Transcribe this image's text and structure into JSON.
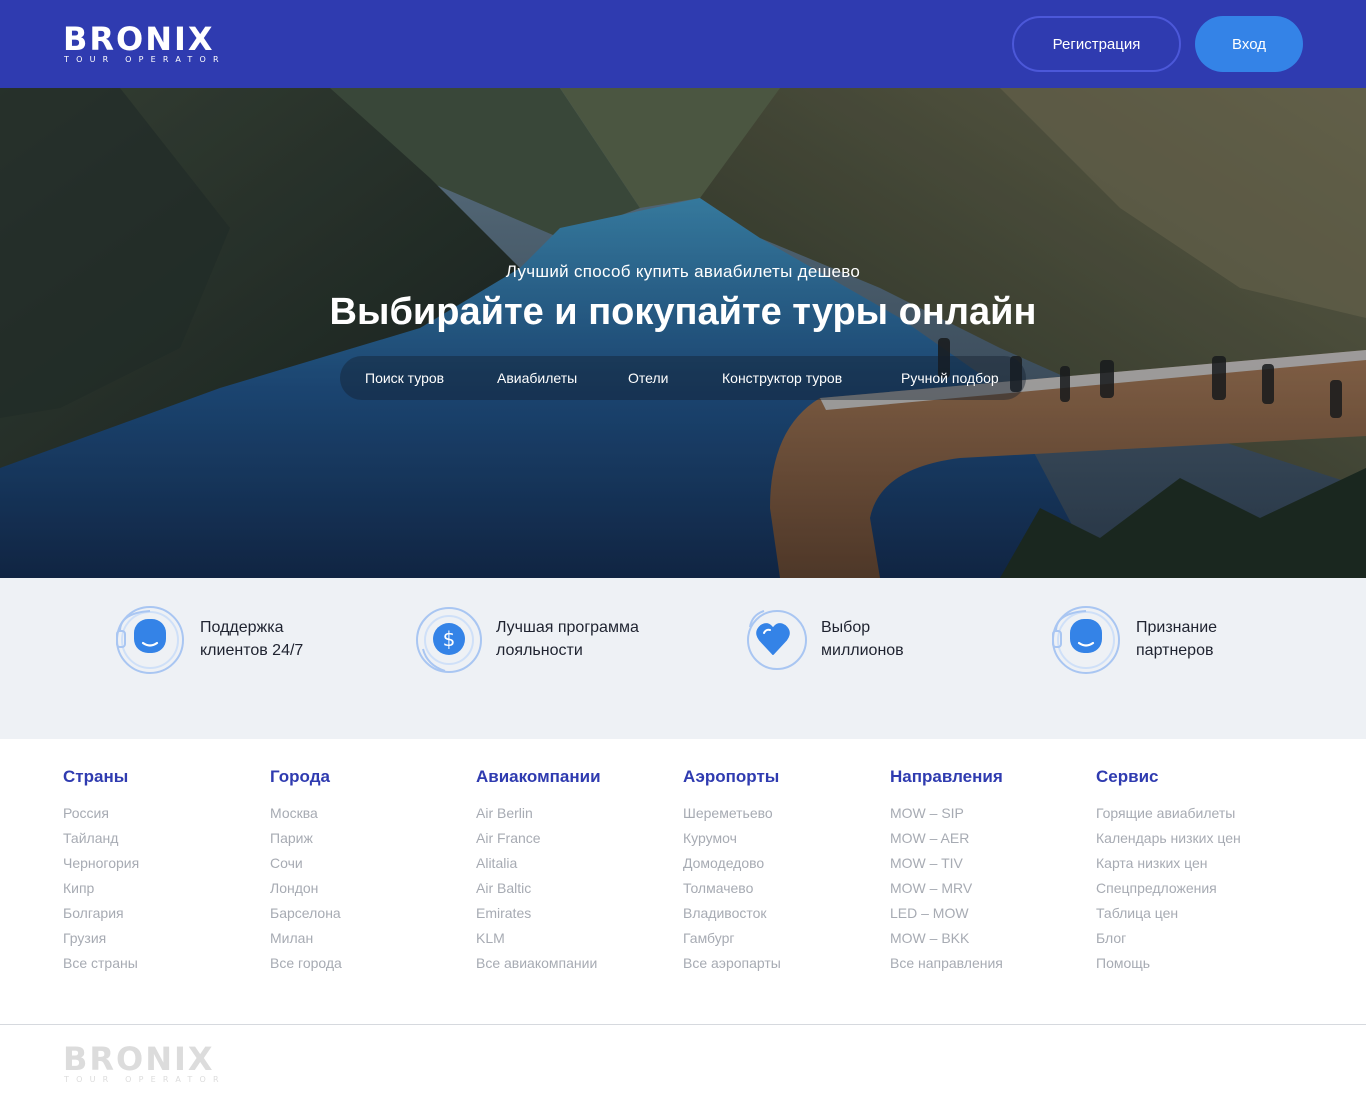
{
  "header": {
    "logo_word": "BRONIX",
    "logo_sub": "TOUR OPERATOR",
    "register_label": "Регистрация",
    "login_label": "Вход"
  },
  "hero": {
    "subtitle": "Лучший способ купить авиабилеты дешево",
    "title": "Выбирайте и покупайте туры онлайн",
    "tabs": [
      "Поиск туров",
      "Авиабилеты",
      "Отели",
      "Конструктор туров",
      "Ручной подбор"
    ]
  },
  "features": [
    {
      "icon": "support-headset-icon",
      "line1": "Поддержка",
      "line2": "клиентов 24/7"
    },
    {
      "icon": "dollar-coin-icon",
      "line1": "Лучшая программа",
      "line2": "лояльности"
    },
    {
      "icon": "heart-icon",
      "line1": "Выбор",
      "line2": "миллионов"
    },
    {
      "icon": "support-headset-icon",
      "line1": "Признание",
      "line2": "партнеров"
    }
  ],
  "footer": {
    "columns": [
      {
        "title": "Страны",
        "links": [
          "Россия",
          "Тайланд",
          "Черногория",
          "Кипр",
          "Болгария",
          "Грузия",
          "Все страны"
        ]
      },
      {
        "title": "Города",
        "links": [
          "Москва",
          "Париж",
          "Сочи",
          "Лондон",
          "Барселона",
          "Милан",
          "Все города"
        ]
      },
      {
        "title": "Авиакомпании",
        "links": [
          "Air Berlin",
          "Air France",
          "Alitalia",
          "Air Baltic",
          "Emirates",
          "KLM",
          "Все авиакомпании"
        ]
      },
      {
        "title": "Аэропорты",
        "links": [
          "Шереметьево",
          "Курумоч",
          "Домодедово",
          "Толмачево",
          "Владивосток",
          "Гамбург",
          "Все аэропарты"
        ]
      },
      {
        "title": "Направления",
        "links": [
          "MOW – SIP",
          "MOW – AER",
          "MOW – TIV",
          "MOW – MRV",
          "LED – MOW",
          "MOW – BKK",
          "Все направления"
        ]
      },
      {
        "title": "Сервис",
        "links": [
          "Горящие авиабилеты",
          "Календарь низких цен",
          "Карта низких цен",
          "Спецпредложения",
          "Таблица цен",
          "Блог",
          "Помощь"
        ]
      }
    ],
    "logo_word": "BRONIX",
    "logo_sub": "TOUR OPERATOR"
  },
  "colors": {
    "header_bg": "#2f3bb0",
    "accent_blue": "#3483e7",
    "features_bg": "#eef1f5",
    "link_gray": "#a7abb3",
    "title_blue": "#2f3bb0"
  }
}
